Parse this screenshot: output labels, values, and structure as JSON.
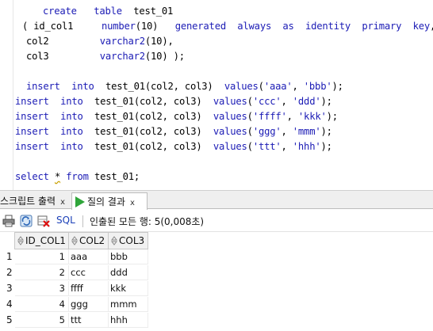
{
  "editor": {
    "lines": [
      {
        "id": "l1",
        "parts": [
          [
            "kw",
            "create"
          ],
          [
            "t",
            "   "
          ],
          [
            "kw",
            "table"
          ],
          [
            "t",
            "  test_01"
          ]
        ]
      },
      {
        "id": "l2",
        "parts": [
          [
            "t",
            "( id_col1     "
          ],
          [
            "kw",
            "number"
          ],
          [
            "t",
            "(10)   "
          ],
          [
            "kw",
            "generated"
          ],
          [
            "t",
            "  "
          ],
          [
            "kw",
            "always"
          ],
          [
            "t",
            "  "
          ],
          [
            "kw",
            "as"
          ],
          [
            "t",
            "  "
          ],
          [
            "kw",
            "identity"
          ],
          [
            "t",
            "  "
          ],
          [
            "kw",
            "primary"
          ],
          [
            "t",
            "  "
          ],
          [
            "kw",
            "key"
          ],
          [
            "t",
            ","
          ]
        ]
      },
      {
        "id": "l3",
        "parts": [
          [
            "t",
            "col2         "
          ],
          [
            "kw",
            "varchar2"
          ],
          [
            "t",
            "(10),"
          ]
        ]
      },
      {
        "id": "l4",
        "parts": [
          [
            "t",
            "col3         "
          ],
          [
            "kw",
            "varchar2"
          ],
          [
            "t",
            "(10) );"
          ]
        ]
      },
      {
        "id": "l5",
        "parts": []
      },
      {
        "id": "l6",
        "parts": [
          [
            "kw",
            "insert"
          ],
          [
            "t",
            "  "
          ],
          [
            "kw",
            "into"
          ],
          [
            "t",
            "  test_01(col2, col3)  "
          ],
          [
            "kw",
            "values"
          ],
          [
            "t",
            "("
          ],
          [
            "str",
            "'aaa'"
          ],
          [
            "t",
            ", "
          ],
          [
            "str",
            "'bbb'"
          ],
          [
            "t",
            ");"
          ]
        ]
      },
      {
        "id": "l7",
        "parts": [
          [
            "kw",
            "insert"
          ],
          [
            "t",
            "  "
          ],
          [
            "kw",
            "into"
          ],
          [
            "t",
            "  test_01(col2, col3)  "
          ],
          [
            "kw",
            "values"
          ],
          [
            "t",
            "("
          ],
          [
            "str",
            "'ccc'"
          ],
          [
            "t",
            ", "
          ],
          [
            "str",
            "'ddd'"
          ],
          [
            "t",
            ");"
          ]
        ]
      },
      {
        "id": "l8",
        "parts": [
          [
            "kw",
            "insert"
          ],
          [
            "t",
            "  "
          ],
          [
            "kw",
            "into"
          ],
          [
            "t",
            "  test_01(col2, col3)  "
          ],
          [
            "kw",
            "values"
          ],
          [
            "t",
            "("
          ],
          [
            "str",
            "'ffff'"
          ],
          [
            "t",
            ", "
          ],
          [
            "str",
            "'kkk'"
          ],
          [
            "t",
            ");"
          ]
        ]
      },
      {
        "id": "l9",
        "parts": [
          [
            "kw",
            "insert"
          ],
          [
            "t",
            "  "
          ],
          [
            "kw",
            "into"
          ],
          [
            "t",
            "  test_01(col2, col3)  "
          ],
          [
            "kw",
            "values"
          ],
          [
            "t",
            "("
          ],
          [
            "str",
            "'ggg'"
          ],
          [
            "t",
            ", "
          ],
          [
            "str",
            "'mmm'"
          ],
          [
            "t",
            ");"
          ]
        ]
      },
      {
        "id": "l10",
        "parts": [
          [
            "kw",
            "insert"
          ],
          [
            "t",
            "  "
          ],
          [
            "kw",
            "into"
          ],
          [
            "t",
            "  test_01(col2, col3)  "
          ],
          [
            "kw",
            "values"
          ],
          [
            "t",
            "("
          ],
          [
            "str",
            "'ttt'"
          ],
          [
            "t",
            ", "
          ],
          [
            "str",
            "'hhh'"
          ],
          [
            "t",
            ");"
          ]
        ]
      },
      {
        "id": "l11",
        "parts": []
      },
      {
        "id": "l12",
        "parts": [
          [
            "kw",
            "select"
          ],
          [
            "t",
            " "
          ],
          [
            "sq",
            "*"
          ],
          [
            "t",
            " "
          ],
          [
            "kw",
            "from"
          ],
          [
            "t",
            " test_01;"
          ]
        ]
      }
    ]
  },
  "tabs": {
    "script_output": "스크립트 출력",
    "query_result": "질의 결과",
    "close": "x"
  },
  "toolbar": {
    "sql_label": "SQL",
    "status": "인출된 모든 행: 5(0,008초)"
  },
  "grid": {
    "columns": [
      "ID_COL1",
      "COL2",
      "COL3"
    ],
    "rows": [
      {
        "n": "1",
        "id": "1",
        "col2": "aaa",
        "col3": "bbb"
      },
      {
        "n": "2",
        "id": "2",
        "col2": "ccc",
        "col3": "ddd"
      },
      {
        "n": "3",
        "id": "3",
        "col2": "ffff",
        "col3": "kkk"
      },
      {
        "n": "4",
        "id": "4",
        "col2": "ggg",
        "col3": "mmm"
      },
      {
        "n": "5",
        "id": "5",
        "col2": "ttt",
        "col3": "hhh"
      }
    ]
  },
  "colors": {
    "keyword": "#1b1bb5",
    "run_icon": "#2fa53a",
    "sql_link": "#1a3fb8"
  },
  "icons": [
    "print-icon",
    "refresh-icon",
    "delete-icon",
    "run-icon",
    "sort-icon"
  ]
}
